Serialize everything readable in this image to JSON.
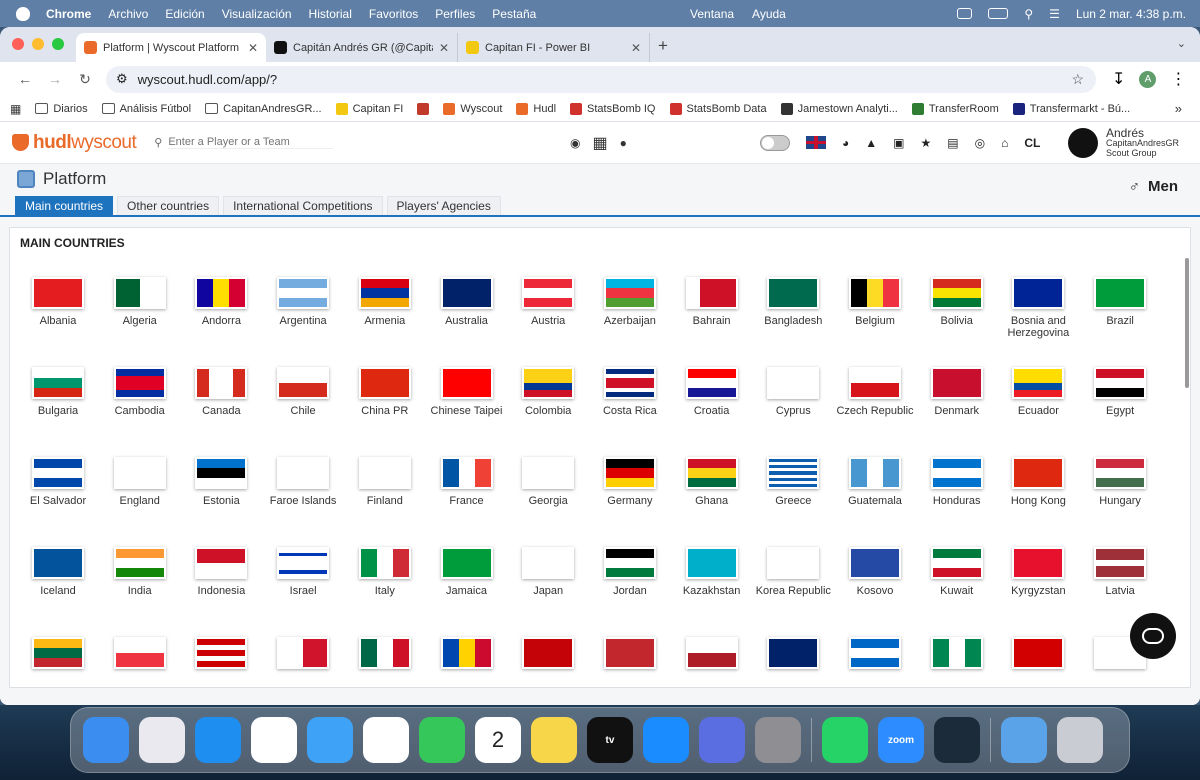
{
  "menubar": {
    "app": "Chrome",
    "items": [
      "Archivo",
      "Edición",
      "Visualización",
      "Historial",
      "Favoritos",
      "Perfiles",
      "Pestaña"
    ],
    "center": [
      "Ventana",
      "Ayuda"
    ],
    "clock": "Lun 2 mar.  4:38 p.m."
  },
  "browser": {
    "tabs": [
      {
        "title": "Platform | Wyscout Platform",
        "color": "#ea6a2a"
      },
      {
        "title": "Capitán Andrés GR (@Capitan",
        "color": "#111111"
      },
      {
        "title": "Capitan FI - Power BI",
        "color": "#f2c811"
      }
    ],
    "new_tab": "+",
    "url": "wyscout.hudl.com/app/?",
    "profile_initial": "A",
    "bookmarks": [
      {
        "label": "Diarios",
        "kind": "folder"
      },
      {
        "label": "Análisis Fútbol",
        "kind": "folder"
      },
      {
        "label": "CapitanAndresGR...",
        "kind": "folder"
      },
      {
        "label": "Capitan FI",
        "kind": "icon",
        "color": "#f2c811"
      },
      {
        "label": "",
        "kind": "icon",
        "color": "#c0392b"
      },
      {
        "label": "Wyscout",
        "kind": "icon",
        "color": "#ea6a2a"
      },
      {
        "label": "Hudl",
        "kind": "icon",
        "color": "#ea6a2a"
      },
      {
        "label": "StatsBomb IQ",
        "kind": "icon",
        "color": "#d0312d"
      },
      {
        "label": "StatsBomb Data",
        "kind": "icon",
        "color": "#d0312d"
      },
      {
        "label": "Jamestown Analyti...",
        "kind": "icon",
        "color": "#333"
      },
      {
        "label": "TransferRoom",
        "kind": "icon",
        "color": "#2e7d32"
      },
      {
        "label": "Transfermarkt - Bú...",
        "kind": "icon",
        "color": "#1a237e"
      }
    ]
  },
  "app": {
    "logo_hudl": "hudl",
    "logo_wyscout": "wyscout",
    "search_placeholder": "Enter a Player or a Team",
    "lang": "CL",
    "user": {
      "name": "Andrés",
      "handle": "CapitanAndresGR",
      "group": "Scout Group"
    },
    "platform_title": "Platform",
    "gender": "Men",
    "tabs": [
      "Main countries",
      "Other countries",
      "International Competitions",
      "Players' Agencies"
    ],
    "section_title": "MAIN COUNTRIES"
  },
  "countries": [
    {
      "name": "Albania",
      "flag": [
        "#e41e20"
      ]
    },
    {
      "name": "Algeria",
      "flag": [
        "#006233",
        "#ffffff"
      ],
      "dir": "v"
    },
    {
      "name": "Andorra",
      "flag": [
        "#10069f",
        "#fedf00",
        "#d50032"
      ],
      "dir": "v"
    },
    {
      "name": "Argentina",
      "flag": [
        "#74acdf",
        "#ffffff",
        "#74acdf"
      ]
    },
    {
      "name": "Armenia",
      "flag": [
        "#d90012",
        "#0033a0",
        "#f2a800"
      ]
    },
    {
      "name": "Australia",
      "flag": [
        "#012169"
      ]
    },
    {
      "name": "Austria",
      "flag": [
        "#ed2939",
        "#ffffff",
        "#ed2939"
      ]
    },
    {
      "name": "Azerbaijan",
      "flag": [
        "#00b5e2",
        "#ef3340",
        "#509e2f"
      ]
    },
    {
      "name": "Bahrain",
      "flag": [
        "#ffffff",
        "#ce1126"
      ],
      "dir": "v",
      "ratio": "1fr 3fr"
    },
    {
      "name": "Bangladesh",
      "flag": [
        "#006a4e"
      ]
    },
    {
      "name": "Belgium",
      "flag": [
        "#000000",
        "#fdda24",
        "#ef3340"
      ],
      "dir": "v"
    },
    {
      "name": "Bolivia",
      "flag": [
        "#d52b1e",
        "#f9e300",
        "#007934"
      ]
    },
    {
      "name": "Bosnia and Herzegovina",
      "flag": [
        "#002395"
      ]
    },
    {
      "name": "Brazil",
      "flag": [
        "#009c3b"
      ]
    },
    {
      "name": "Bulgaria",
      "flag": [
        "#ffffff",
        "#00966e",
        "#d62612"
      ]
    },
    {
      "name": "Cambodia",
      "flag": [
        "#032ea1",
        "#e00025",
        "#032ea1"
      ],
      "ratio": "1fr 2fr 1fr"
    },
    {
      "name": "Canada",
      "flag": [
        "#d52b1e",
        "#ffffff",
        "#d52b1e"
      ],
      "dir": "v",
      "ratio": "1fr 2fr 1fr"
    },
    {
      "name": "Chile",
      "flag": [
        "#ffffff",
        "#d52b1e"
      ]
    },
    {
      "name": "China PR",
      "flag": [
        "#de2910"
      ]
    },
    {
      "name": "Chinese Taipei",
      "flag": [
        "#fe0000"
      ]
    },
    {
      "name": "Colombia",
      "flag": [
        "#fcd116",
        "#003893",
        "#ce1126"
      ],
      "ratio": "2fr 1fr 1fr"
    },
    {
      "name": "Costa Rica",
      "flag": [
        "#002b7f",
        "#ffffff",
        "#ce1126",
        "#ffffff",
        "#002b7f"
      ],
      "ratio": "1fr 1fr 2fr 1fr 1fr"
    },
    {
      "name": "Croatia",
      "flag": [
        "#ff0000",
        "#ffffff",
        "#171796"
      ]
    },
    {
      "name": "Cyprus",
      "flag": [
        "#ffffff"
      ]
    },
    {
      "name": "Czech Republic",
      "flag": [
        "#ffffff",
        "#d7141a"
      ]
    },
    {
      "name": "Denmark",
      "flag": [
        "#c8102e"
      ]
    },
    {
      "name": "Ecuador",
      "flag": [
        "#ffdd00",
        "#034ea2",
        "#ed1c24"
      ],
      "ratio": "2fr 1fr 1fr"
    },
    {
      "name": "Egypt",
      "flag": [
        "#ce1126",
        "#ffffff",
        "#000000"
      ]
    },
    {
      "name": "El Salvador",
      "flag": [
        "#0047ab",
        "#ffffff",
        "#0047ab"
      ]
    },
    {
      "name": "England",
      "flag": [
        "#ffffff"
      ]
    },
    {
      "name": "Estonia",
      "flag": [
        "#0072ce",
        "#000000",
        "#ffffff"
      ]
    },
    {
      "name": "Faroe Islands",
      "flag": [
        "#ffffff"
      ]
    },
    {
      "name": "Finland",
      "flag": [
        "#ffffff"
      ]
    },
    {
      "name": "France",
      "flag": [
        "#0055a4",
        "#ffffff",
        "#ef4135"
      ],
      "dir": "v"
    },
    {
      "name": "Georgia",
      "flag": [
        "#ffffff"
      ]
    },
    {
      "name": "Germany",
      "flag": [
        "#000000",
        "#dd0000",
        "#ffce00"
      ]
    },
    {
      "name": "Ghana",
      "flag": [
        "#ce1126",
        "#fcd116",
        "#006b3f"
      ]
    },
    {
      "name": "Greece",
      "flag": [
        "#0d5eaf",
        "#ffffff",
        "#0d5eaf",
        "#ffffff",
        "#0d5eaf",
        "#ffffff",
        "#0d5eaf",
        "#ffffff",
        "#0d5eaf"
      ]
    },
    {
      "name": "Guatemala",
      "flag": [
        "#4997d0",
        "#ffffff",
        "#4997d0"
      ],
      "dir": "v"
    },
    {
      "name": "Honduras",
      "flag": [
        "#0073cf",
        "#ffffff",
        "#0073cf"
      ]
    },
    {
      "name": "Hong Kong",
      "flag": [
        "#de2910"
      ]
    },
    {
      "name": "Hungary",
      "flag": [
        "#cd2a3e",
        "#ffffff",
        "#436f4d"
      ]
    },
    {
      "name": "Iceland",
      "flag": [
        "#02529c"
      ]
    },
    {
      "name": "India",
      "flag": [
        "#ff9933",
        "#ffffff",
        "#138808"
      ]
    },
    {
      "name": "Indonesia",
      "flag": [
        "#ce1126",
        "#ffffff"
      ]
    },
    {
      "name": "Israel",
      "flag": [
        "#ffffff",
        "#0038b8",
        "#ffffff",
        "#0038b8",
        "#ffffff"
      ],
      "ratio": "1fr 1fr 4fr 1fr 1fr"
    },
    {
      "name": "Italy",
      "flag": [
        "#009246",
        "#ffffff",
        "#ce2b37"
      ],
      "dir": "v"
    },
    {
      "name": "Jamaica",
      "flag": [
        "#009b3a"
      ]
    },
    {
      "name": "Japan",
      "flag": [
        "#ffffff"
      ]
    },
    {
      "name": "Jordan",
      "flag": [
        "#000000",
        "#ffffff",
        "#007a3d"
      ]
    },
    {
      "name": "Kazakhstan",
      "flag": [
        "#00afca"
      ]
    },
    {
      "name": "Korea Republic",
      "flag": [
        "#ffffff"
      ]
    },
    {
      "name": "Kosovo",
      "flag": [
        "#244aa5"
      ]
    },
    {
      "name": "Kuwait",
      "flag": [
        "#007a3d",
        "#ffffff",
        "#ce1126"
      ]
    },
    {
      "name": "Kyrgyzstan",
      "flag": [
        "#e8112d"
      ]
    },
    {
      "name": "Latvia",
      "flag": [
        "#9e3039",
        "#ffffff",
        "#9e3039"
      ],
      "ratio": "2fr 1fr 2fr"
    },
    {
      "name": "",
      "flag": [
        "#fdb913",
        "#006a44",
        "#c1272d"
      ]
    },
    {
      "name": "",
      "flag": [
        "#ffffff",
        "#ef3340"
      ]
    },
    {
      "name": "",
      "flag": [
        "#cc0001",
        "#ffffff",
        "#cc0001",
        "#ffffff",
        "#cc0001"
      ]
    },
    {
      "name": "",
      "flag": [
        "#ffffff",
        "#cf142b"
      ],
      "dir": "v"
    },
    {
      "name": "",
      "flag": [
        "#006847",
        "#ffffff",
        "#ce1126"
      ],
      "dir": "v"
    },
    {
      "name": "",
      "flag": [
        "#0046ae",
        "#ffd200",
        "#cc092f"
      ],
      "dir": "v"
    },
    {
      "name": "",
      "flag": [
        "#c40308"
      ]
    },
    {
      "name": "",
      "flag": [
        "#c1272d"
      ]
    },
    {
      "name": "",
      "flag": [
        "#ffffff",
        "#ae1c28"
      ]
    },
    {
      "name": "",
      "flag": [
        "#012169"
      ]
    },
    {
      "name": "",
      "flag": [
        "#0067c6",
        "#ffffff",
        "#0067c6"
      ]
    },
    {
      "name": "",
      "flag": [
        "#008751",
        "#ffffff",
        "#008751"
      ],
      "dir": "v"
    },
    {
      "name": "",
      "flag": [
        "#d20000"
      ]
    },
    {
      "name": "",
      "flag": [
        "#ffffff"
      ]
    }
  ],
  "dock": [
    {
      "name": "finder",
      "color": "#3b8ef0"
    },
    {
      "name": "launchpad",
      "color": "#e9e9ef"
    },
    {
      "name": "safari",
      "color": "#1f8ef1"
    },
    {
      "name": "chrome",
      "color": "#ffffff"
    },
    {
      "name": "mail",
      "color": "#3ea2f7"
    },
    {
      "name": "photos",
      "color": "#ffffff"
    },
    {
      "name": "facetime",
      "color": "#35c759"
    },
    {
      "name": "calendar",
      "color": "#ffffff",
      "label": "2",
      "sub": "Lun"
    },
    {
      "name": "notes",
      "color": "#f7d64a"
    },
    {
      "name": "appletv",
      "color": "#111111",
      "label": "tv"
    },
    {
      "name": "appstore",
      "color": "#1a8cff"
    },
    {
      "name": "configurator",
      "color": "#5b6ee1"
    },
    {
      "name": "settings",
      "color": "#8e8e93"
    },
    {
      "name": "whatsapp",
      "color": "#25d366"
    },
    {
      "name": "zoom",
      "color": "#2d8cff",
      "label": "zoom"
    },
    {
      "name": "tunnel",
      "color": "#1c2b3a"
    },
    {
      "name": "folder",
      "color": "#5aa3e8"
    },
    {
      "name": "trash",
      "color": "#c9ccd2"
    }
  ]
}
